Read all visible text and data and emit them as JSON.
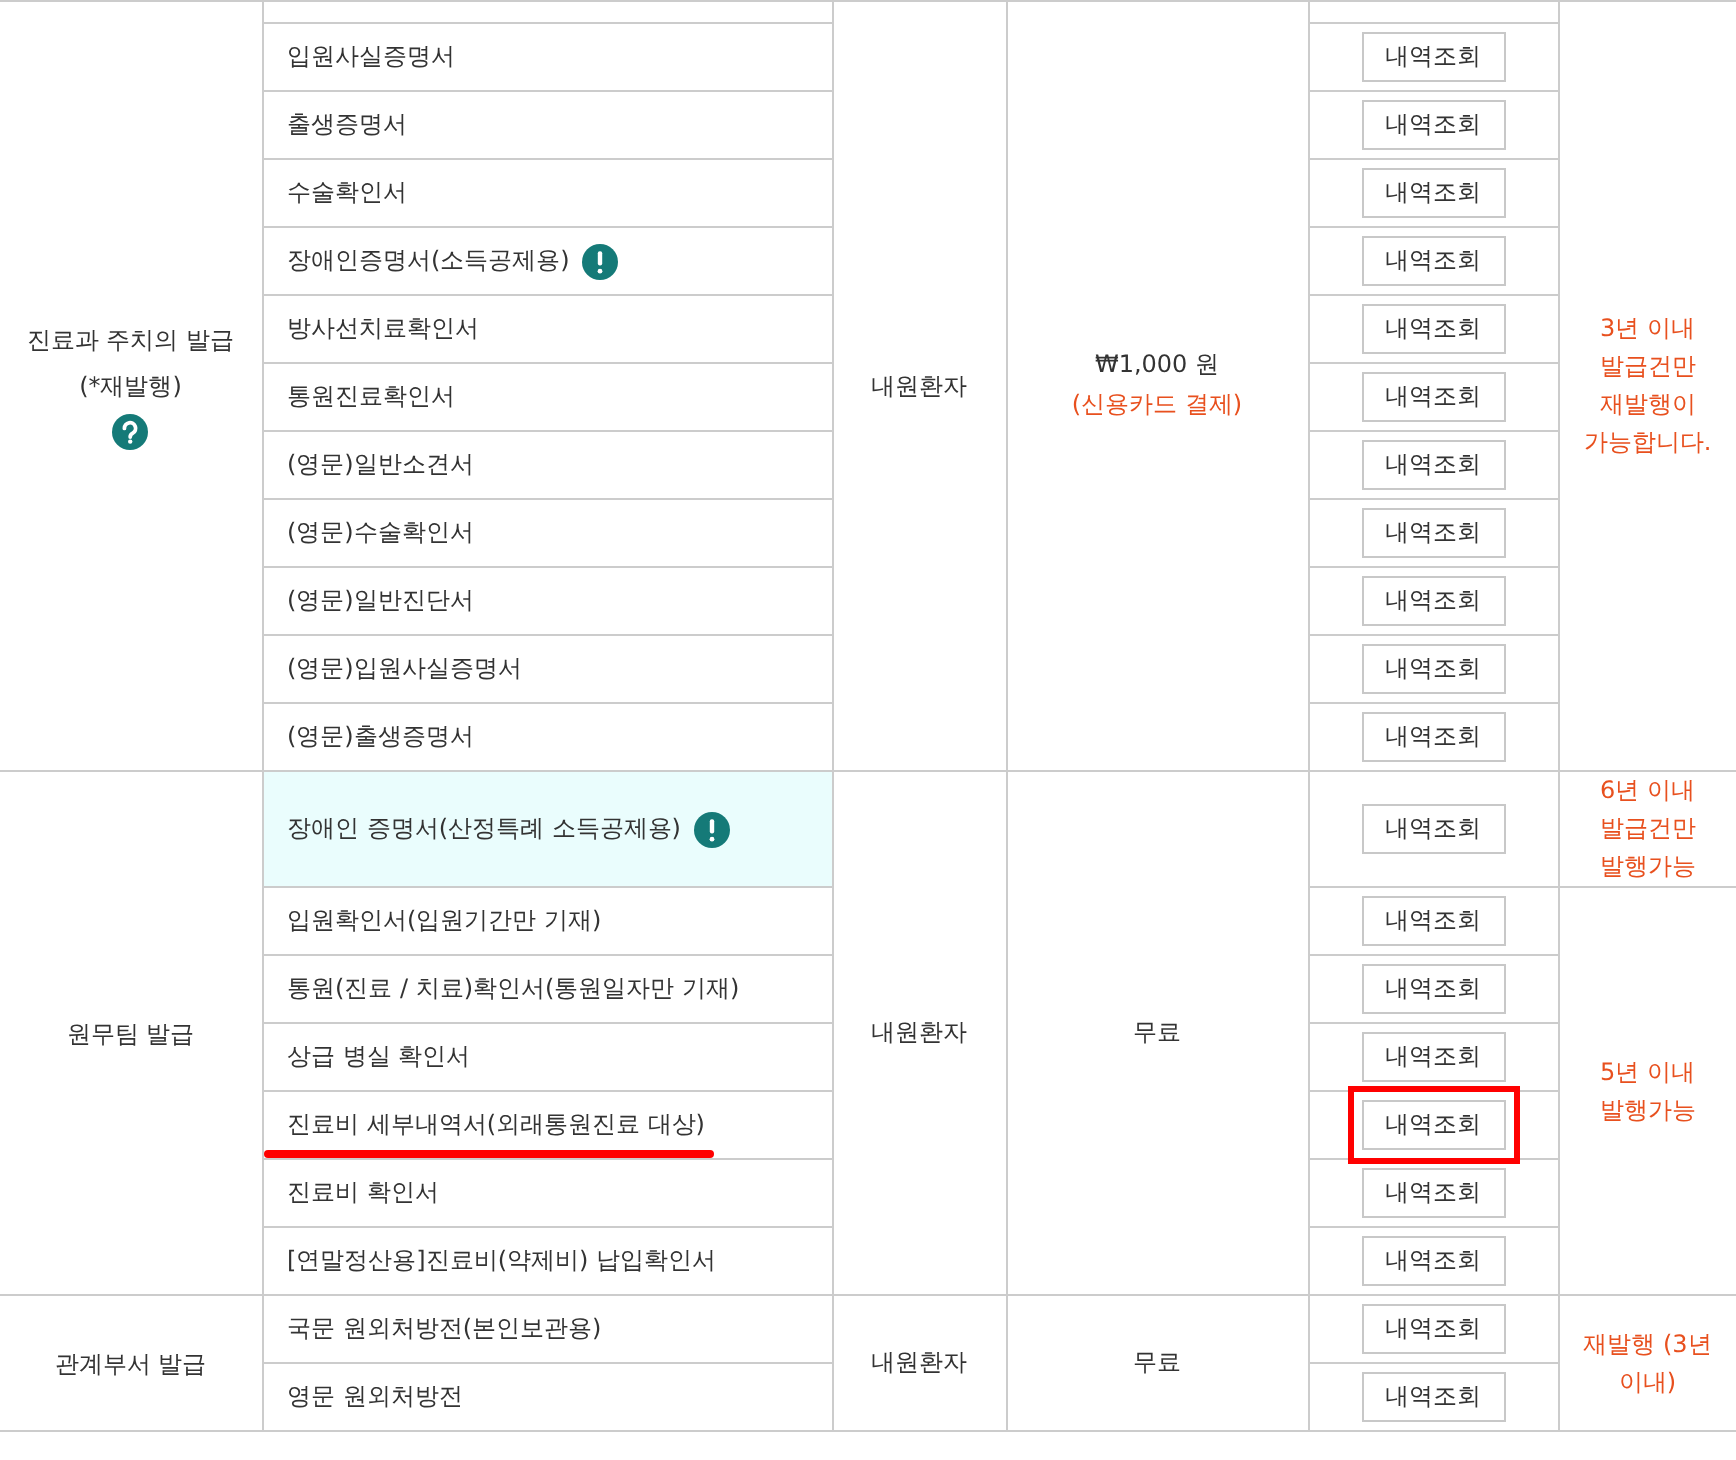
{
  "groups": [
    {
      "category": "진료과 주치의 발급",
      "category_note": "(*재발행)",
      "help_icon": true,
      "target": "내원환자",
      "fee": "₩1,000 원",
      "fee_note": "(신용카드 결제)",
      "sections": [
        {
          "note": "3년 이내 발급건만 재발행이 가능합니다.",
          "rows": [
            {
              "name": "입원사실증명서",
              "alert": false,
              "tinted": false,
              "annotated": false,
              "button": "내역조회"
            },
            {
              "name": "출생증명서",
              "alert": false,
              "tinted": false,
              "annotated": false,
              "button": "내역조회"
            },
            {
              "name": "수술확인서",
              "alert": false,
              "tinted": false,
              "annotated": false,
              "button": "내역조회"
            },
            {
              "name": "장애인증명서(소득공제용)",
              "alert": true,
              "tinted": false,
              "annotated": false,
              "button": "내역조회"
            },
            {
              "name": "방사선치료확인서",
              "alert": false,
              "tinted": false,
              "annotated": false,
              "button": "내역조회"
            },
            {
              "name": "통원진료확인서",
              "alert": false,
              "tinted": false,
              "annotated": false,
              "button": "내역조회"
            },
            {
              "name": "(영문)일반소견서",
              "alert": false,
              "tinted": false,
              "annotated": false,
              "button": "내역조회"
            },
            {
              "name": "(영문)수술확인서",
              "alert": false,
              "tinted": false,
              "annotated": false,
              "button": "내역조회"
            },
            {
              "name": "(영문)일반진단서",
              "alert": false,
              "tinted": false,
              "annotated": false,
              "button": "내역조회"
            },
            {
              "name": "(영문)입원사실증명서",
              "alert": false,
              "tinted": false,
              "annotated": false,
              "button": "내역조회"
            },
            {
              "name": "(영문)출생증명서",
              "alert": false,
              "tinted": false,
              "annotated": false,
              "button": "내역조회"
            }
          ]
        }
      ]
    },
    {
      "category": "원무팀 발급",
      "help_icon": false,
      "target": "내원환자",
      "fee": "무료",
      "sections": [
        {
          "note": "6년 이내 발급건만 발행가능",
          "rows": [
            {
              "name": "장애인 증명서(산정특례 소득공제용)",
              "alert": true,
              "tinted": true,
              "annotated": false,
              "button": "내역조회"
            }
          ]
        },
        {
          "note": "5년 이내 발행가능",
          "rows": [
            {
              "name": "입원확인서(입원기간만 기재)",
              "alert": false,
              "tinted": false,
              "annotated": false,
              "button": "내역조회"
            },
            {
              "name": "통원(진료 / 치료)확인서(통원일자만 기재)",
              "alert": false,
              "tinted": false,
              "annotated": false,
              "button": "내역조회"
            },
            {
              "name": "상급 병실 확인서",
              "alert": false,
              "tinted": false,
              "annotated": false,
              "button": "내역조회"
            },
            {
              "name": "진료비 세부내역서(외래통원진료 대상)",
              "alert": false,
              "tinted": false,
              "annotated": true,
              "button": "내역조회"
            },
            {
              "name": "진료비 확인서",
              "alert": false,
              "tinted": false,
              "annotated": false,
              "button": "내역조회"
            },
            {
              "name": "[연말정산용]진료비(약제비) 납입확인서",
              "alert": false,
              "tinted": false,
              "annotated": false,
              "button": "내역조회"
            }
          ]
        }
      ]
    },
    {
      "category": "관계부서 발급",
      "help_icon": false,
      "target": "내원환자",
      "fee": "무료",
      "sections": [
        {
          "note": "재발행 (3년 이내)",
          "rows": [
            {
              "name": "국문 원외처방전(본인보관용)",
              "alert": false,
              "tinted": false,
              "annotated": false,
              "button": "내역조회"
            },
            {
              "name": "영문 원외처방전",
              "alert": false,
              "tinted": false,
              "annotated": false,
              "button": "내역조회"
            }
          ]
        }
      ]
    }
  ]
}
